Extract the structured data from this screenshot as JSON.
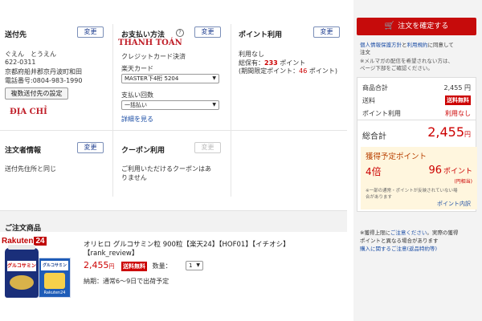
{
  "shipping": {
    "title": "送付先",
    "change": "変更",
    "name": "ぐえん　とうえん",
    "zip": "622-0311",
    "address": "京都府船井郡京丹波町和田",
    "phone": "電話番号:0804-983-1990",
    "multi_button": "複数送付先の設定",
    "annotation": "ĐỊA CHỈ"
  },
  "payment": {
    "title": "お支払い方法",
    "help_icon": "?",
    "change": "変更",
    "annotation": "THANH TOÁN",
    "method": "クレジットカード決済",
    "card_label": "楽天カード",
    "card_value": "MASTER下4桁 5204",
    "installment_label": "支払い回数",
    "installment_value": "一括払い",
    "details_link": "詳細を見る"
  },
  "points": {
    "title": "ポイント利用",
    "change": "変更",
    "none": "利用なし",
    "owned_prefix": "総保有：",
    "owned_value": "233",
    "owned_suffix": " ポイント",
    "limited_prefix": "(期間限定ポイント：",
    "limited_value": "46",
    "limited_suffix": " ポイント)"
  },
  "orderer": {
    "title": "注文者情報",
    "change": "変更",
    "value": "送付先住所と同じ"
  },
  "coupon": {
    "title": "クーポン利用",
    "change": "変更",
    "line1": "ご利用いただけるクーポンはあ",
    "line2": "りません"
  },
  "product": {
    "section_title": "ご注文商品",
    "brand": "Rakuten",
    "brand_num": "24",
    "name_line1": "オリヒロ グルコサミン粒 900粒【楽天24】【HOF01】【イチオシ】",
    "name_line2": "【rank_review】",
    "price": "2,455",
    "yen": "円",
    "free_shipping": "送料無料",
    "qty_label": "数量：",
    "qty_value": "1",
    "delivery": "納期：通常6～9日で出荷予定",
    "bottle_label_main": "グルコサミン",
    "box_label": "グルコサミン",
    "box_brand": "Rakuten24"
  },
  "sidebar": {
    "order_button": "注文を確定する",
    "consent_link1": "個人情報保護方針",
    "consent_and": "と",
    "consent_link2": "利用規約",
    "consent_rest1": "に同意して",
    "consent_rest2": "注文",
    "mail_note1": "※メルマガの配信を希望されない方は、",
    "mail_note2": "ページ下部をご確認ください。",
    "subtotal_label": "商品合計",
    "subtotal_value": "2,455 円",
    "shipping_label": "送料",
    "shipping_tag": "送料無料",
    "point_use_label": "ポイント利用",
    "point_use_value": "利用なし",
    "total_label": "総合計",
    "total_value": "2,455",
    "total_yen": "円",
    "earn_title": "獲得予定ポイント",
    "earn_multiplier": "4倍",
    "earn_points": "96",
    "earn_points_unit": "ポイント",
    "earn_points_sub": "(円相当)",
    "earn_note1": "※一部の通常・ポイントが反映されていない場",
    "earn_note2": "合があります",
    "point_detail_link": "ポイント内訳",
    "footer_note1": "※獲得上限に",
    "footer_link1": "ご注意ください",
    "footer_note1b": "。実際の獲得",
    "footer_note2": "ポイントと異なる場合があります",
    "footer_link2": "購入に関するご注意(返品特約等)"
  },
  "colors": {
    "accent_red": "#c60b0b",
    "link_blue": "#1d4fa6",
    "points_bg": "#fff6de"
  }
}
